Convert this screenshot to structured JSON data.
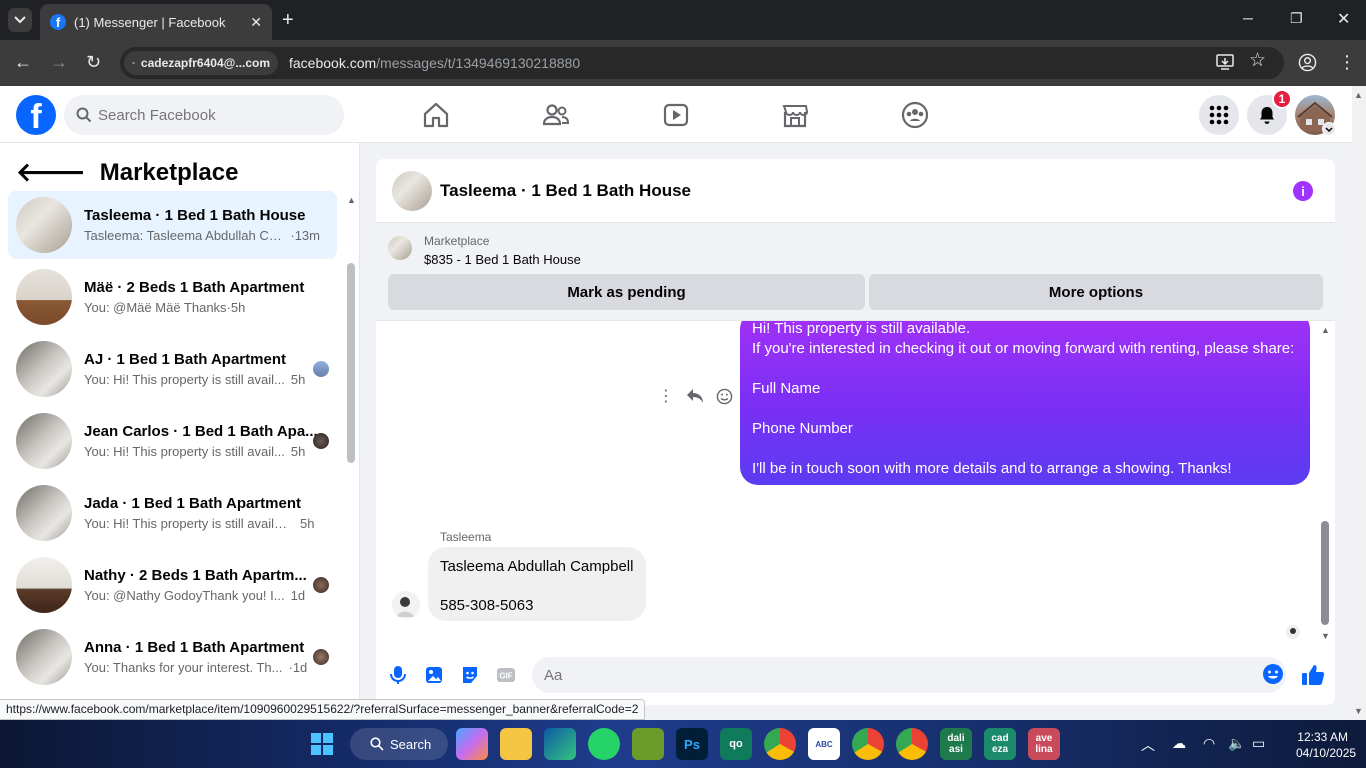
{
  "browser": {
    "tab_title": "(1) Messenger | Facebook",
    "site_chip": "cadezapfr6404@...com",
    "url_domain": "facebook.com",
    "url_path": "/messages/t/1349469130218880",
    "status_url": "https://www.facebook.com/marketplace/item/1090960029515622/?referralSurface=messenger_banner&referralCode=2"
  },
  "header": {
    "logo": "f",
    "search_placeholder": "Search Facebook",
    "notification_count": "1"
  },
  "sidebar": {
    "title": "Marketplace",
    "conversations": [
      {
        "name": "Tasleema · 1 Bed 1 Bath House",
        "preview": "Tasleema: Tasleema Abdullah Ca...",
        "time": "·13m",
        "active": true
      },
      {
        "name": "Mäë · 2 Beds 1 Bath Apartment",
        "preview": "You: @Mäë Mäë Thanks",
        "time": "·5h"
      },
      {
        "name": "AJ · 1 Bed 1 Bath Apartment",
        "preview": "You: Hi! This property is still avail...",
        "time": "5h"
      },
      {
        "name": "Jean Carlos · 1 Bed 1 Bath Apa...",
        "preview": "You: Hi! This property is still avail...",
        "time": "5h"
      },
      {
        "name": "Jada · 1 Bed 1 Bath Apartment",
        "preview": "You: Hi! This property is still availab...",
        "time": "5h"
      },
      {
        "name": "Nathy · 2 Beds 1 Bath Apartm...",
        "preview": "You: @Nathy GodoyThank you! I...",
        "time": "1d"
      },
      {
        "name": "Anna · 1 Bed 1 Bath Apartment",
        "preview": "You: Thanks for your interest. Th...",
        "time": "·1d"
      }
    ]
  },
  "chat": {
    "title": "Tasleema · 1 Bed 1 Bath House",
    "banner_label": "Marketplace",
    "banner_listing": "$835 - 1 Bed 1 Bath House",
    "mark_pending": "Mark as pending",
    "more_options": "More options",
    "outgoing": {
      "line1": "Hi! This property is still available.",
      "line2": "If you're interested in checking it out or moving forward with renting, please share:",
      "line3": "Full Name",
      "line4": "Phone Number",
      "line5": "I'll be in touch soon with more details and to arrange a showing. Thanks!"
    },
    "sender_name": "Tasleema",
    "incoming": {
      "line1": "Tasleema Abdullah Campbell",
      "line2": "585-308-5063"
    },
    "composer_placeholder": "Aa"
  },
  "taskbar": {
    "search_label": "Search",
    "time": "12:33 AM",
    "date": "04/10/2025",
    "apps": [
      "qo",
      "dali asi",
      "cad eza",
      "ave lina"
    ]
  },
  "colors": {
    "fb_blue": "#0866ff",
    "bubble_top": "#a330f7",
    "bubble_bottom": "#5b3cf2",
    "active_conv": "#e7f3ff",
    "info_purple": "#a033ff"
  }
}
